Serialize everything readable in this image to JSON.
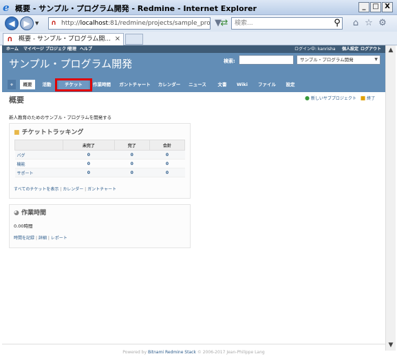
{
  "window": {
    "title": "概要 - サンプル・プログラム開発 - Redmine - Internet Explorer",
    "min": "_",
    "max": "□",
    "close": "X"
  },
  "addressbar": {
    "url_prefix": "http://",
    "url_host": "localhost",
    "url_rest": ":81/redmine/projects/sample_pro",
    "search_placeholder": "検索..."
  },
  "tab": {
    "label": "概要 - サンプル・プログラム開...",
    "close": "×"
  },
  "topmenu": {
    "left": [
      "ホーム",
      "マイページ",
      "プロジェクト",
      "管理",
      "ヘルプ"
    ],
    "logged_in": "ログイン中: kanrisha",
    "personal": "個人設定",
    "logout": "ログアウト"
  },
  "header": {
    "project_title": "サンプル・プログラム開発",
    "search_label": "検索:",
    "project_select": "サンプル・プログラム開発"
  },
  "mainmenu": {
    "tabs": [
      "+",
      "概要",
      "活動",
      "チケット",
      "作業時間",
      "ガントチャート",
      "カレンダー",
      "ニュース",
      "文書",
      "Wiki",
      "ファイル",
      "設定"
    ],
    "selected": "概要",
    "highlighted": "チケット"
  },
  "page": {
    "title": "概要",
    "new_subproject": "新しいサブプロジェクト",
    "close": "終了",
    "description": "新人教育のためのサンプル・プログラムを開発する"
  },
  "issue_tracking": {
    "heading": "チケットトラッキング",
    "columns": [
      "",
      "未完了",
      "完了",
      "合計"
    ],
    "rows": [
      {
        "tracker": "バグ",
        "open": "0",
        "closed": "0",
        "total": "0"
      },
      {
        "tracker": "機能",
        "open": "0",
        "closed": "0",
        "total": "0"
      },
      {
        "tracker": "サポート",
        "open": "0",
        "closed": "0",
        "total": "0"
      }
    ],
    "links": [
      "すべてのチケットを表示",
      "カレンダー",
      "ガントチャート"
    ]
  },
  "spent_time": {
    "heading": "作業時間",
    "value": "0.00時間",
    "links": [
      "時間を記録",
      "詳細",
      "レポート"
    ]
  },
  "footer": {
    "prefix": "Powered by ",
    "link": "Bitnami Redmine Stack",
    "suffix": " © 2006-2017 Jean-Philippe Lang"
  }
}
